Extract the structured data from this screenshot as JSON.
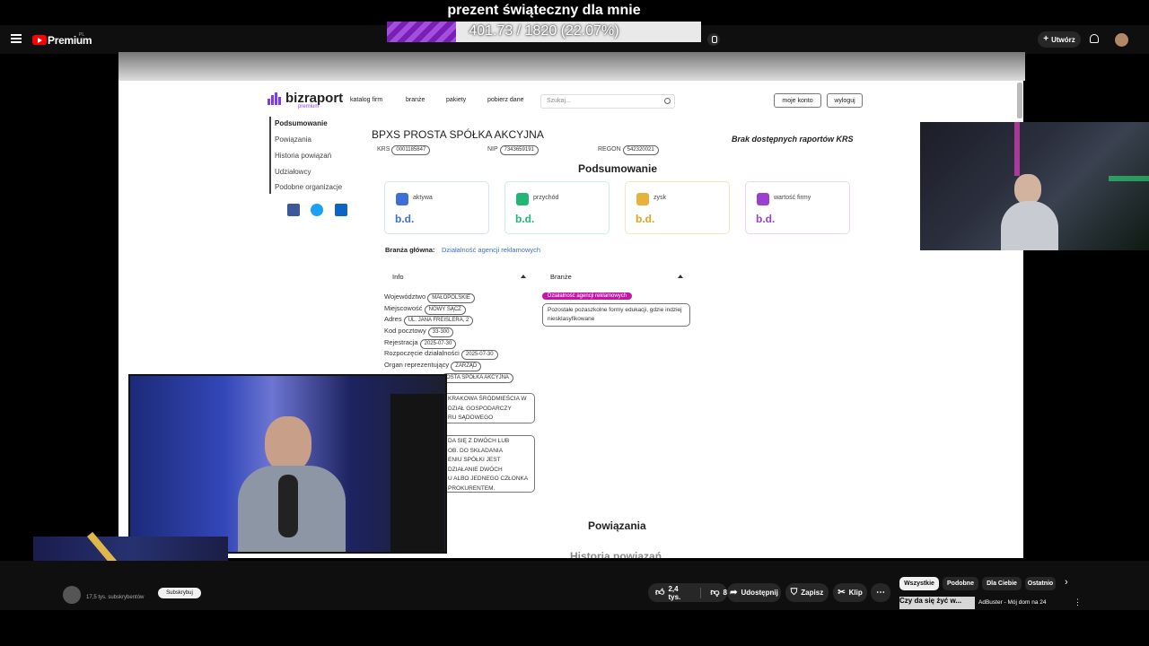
{
  "stream_overlay": {
    "title": "prezent świąteczny dla mnie",
    "progress_text": "401.73 / 1820 (22.07%)",
    "progress_fraction": 0.2207
  },
  "youtube_top": {
    "brand": "Premium",
    "country": "PL",
    "create_label": "Utwórz"
  },
  "site": {
    "logo_text": "bizraport",
    "logo_sub": "premium",
    "nav": [
      "katalog firm",
      "branże",
      "pakiety",
      "pobierz dane"
    ],
    "search_placeholder": "Szukaj...",
    "account_btn": "moje konto",
    "logout_btn": "wyloguj",
    "sidebar": [
      "Podsumowanie",
      "Powiązania",
      "Historia powiązań",
      "Udziałowcy",
      "Podobne organizacje"
    ],
    "company": {
      "name": "BPXS PROSTA SPÓŁKA AKCYJNA",
      "krs_label": "KRS",
      "krs": "0001185847",
      "nip_label": "NIP",
      "nip": "7343659191",
      "regon_label": "REGON",
      "regon": "542320021",
      "krs_note": "Brak dostępnych raportów KRS"
    },
    "summary_title": "Podsumowanie",
    "cards": [
      {
        "label": "aktywa",
        "value": "b.d.",
        "color": "#3d6fd8"
      },
      {
        "label": "przychód",
        "value": "b.d.",
        "color": "#22b573"
      },
      {
        "label": "zysk",
        "value": "b.d.",
        "color": "#d9a521"
      },
      {
        "label": "wartość firmy",
        "value": "b.d.",
        "color": "#9b3fd1"
      }
    ],
    "branza_label": "Branża główna:",
    "branza_value": "Działalność agencji reklamowych",
    "info_header": "Info",
    "branze_header": "Branże",
    "info": [
      {
        "label": "Województwo",
        "value": "MAŁOPOLSKIE"
      },
      {
        "label": "Miejscowość",
        "value": "NOWY SĄCZ"
      },
      {
        "label": "Adres",
        "value": "UL. JANA FREISLERA, 2"
      },
      {
        "label": "Kod pocztowy",
        "value": "33-300"
      },
      {
        "label": "Rejestracja",
        "value": "2025-07-30"
      },
      {
        "label": "Rozpoczęcie działalności",
        "value": "2025-07-30"
      },
      {
        "label": "Organ reprezentujący",
        "value": "ZARZĄD"
      },
      {
        "label": "",
        "value": "OSTA SPÓŁKA AKCYJNA"
      }
    ],
    "court_lines": [
      "KRAKOWA ŚRÓDMIEŚCIA W",
      "DZIAŁ GOSPODARCZY",
      "RU SĄDOWEGO"
    ],
    "representation_lines": [
      "DA SIĘ Z DWÓCH LUB",
      "OB. DO SKŁADANIA",
      "ENIU SPÓŁKI JEST",
      "DZIAŁANIE DWÓCH",
      "U ALBO JEDNEGO CZŁONKA",
      "PROKURENTEM."
    ],
    "branze_active": "Działalność agencji reklamowych",
    "branze_other": "Pozostałe pozaszkolne formy edukacji, gdzie indziej niesklasyfikowane",
    "powiazania_title": "Powiązania",
    "historia_title": "Historia powiązań"
  },
  "youtube_bottom": {
    "subscribers": "17,5 tys. subskrybentów",
    "subscribe_label": "Subskrybuj",
    "likes": "2,4 tys.",
    "dislikes": "8",
    "share_label": "Udostępnij",
    "save_label": "Zapisz",
    "clip_label": "Klip",
    "chips": [
      "Wszystkie",
      "Podobne",
      "Dla Ciebie",
      "Ostatnio"
    ],
    "rec_thumb_text": "Czy da się żyć w...",
    "rec_title": "AdBuster - Mój dom na 24"
  }
}
